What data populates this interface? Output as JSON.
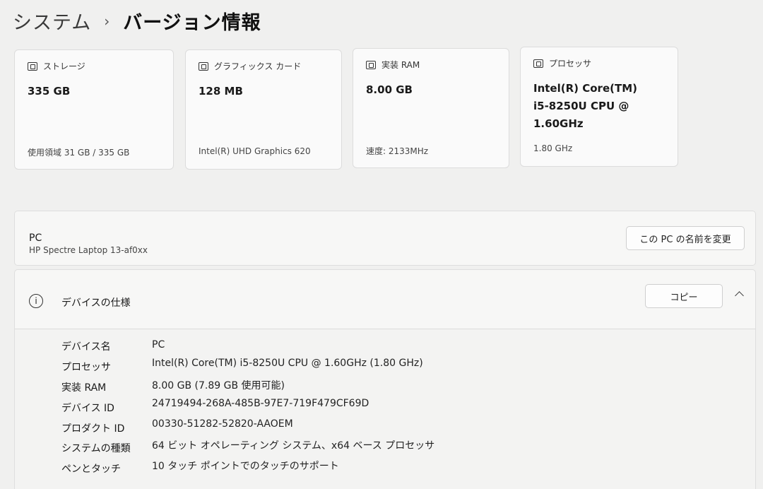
{
  "breadcrumb": {
    "parent": "システム",
    "separator": "›",
    "current": "バージョン情報"
  },
  "cards": {
    "storage": {
      "title": "ストレージ",
      "value": "335 GB",
      "sub": "使用領域 31 GB / 335 GB",
      "icon": "storage-icon"
    },
    "graphics": {
      "title": "グラフィックス カード",
      "value": "128 MB",
      "sub": "Intel(R) UHD Graphics 620",
      "icon": "graphics-card-icon"
    },
    "ram": {
      "title": "実装 RAM",
      "value": "8.00 GB",
      "sub": "速度: 2133MHz",
      "icon": "ram-icon"
    },
    "processor": {
      "title": "プロセッサ",
      "value_line1": "Intel(R) Core(TM)",
      "value_line2": "i5-8250U CPU @",
      "value_line3": "1.60GHz",
      "sub": "1.80 GHz",
      "icon": "processor-icon"
    }
  },
  "pc": {
    "name": "PC",
    "model": "HP Spectre Laptop 13-af0xx",
    "rename_button": "この PC の名前を変更"
  },
  "device_specs": {
    "title": "デバイスの仕様",
    "copy_button": "コピー",
    "rows": [
      {
        "label": "デバイス名",
        "value": "PC"
      },
      {
        "label": "プロセッサ",
        "value": "Intel(R) Core(TM) i5-8250U CPU @ 1.60GHz (1.80 GHz)"
      },
      {
        "label": "実装 RAM",
        "value": "8.00 GB (7.89 GB 使用可能)"
      },
      {
        "label": "デバイス ID",
        "value": "24719494-268A-485B-97E7-719F479CF69D"
      },
      {
        "label": "プロダクト ID",
        "value": "00330-51282-52820-AAOEM"
      },
      {
        "label": "システムの種類",
        "value": "64 ビット オペレーティング システム、x64 ベース プロセッサ"
      },
      {
        "label": "ペンとタッチ",
        "value": "10 タッチ ポイントでのタッチのサポート"
      }
    ]
  }
}
